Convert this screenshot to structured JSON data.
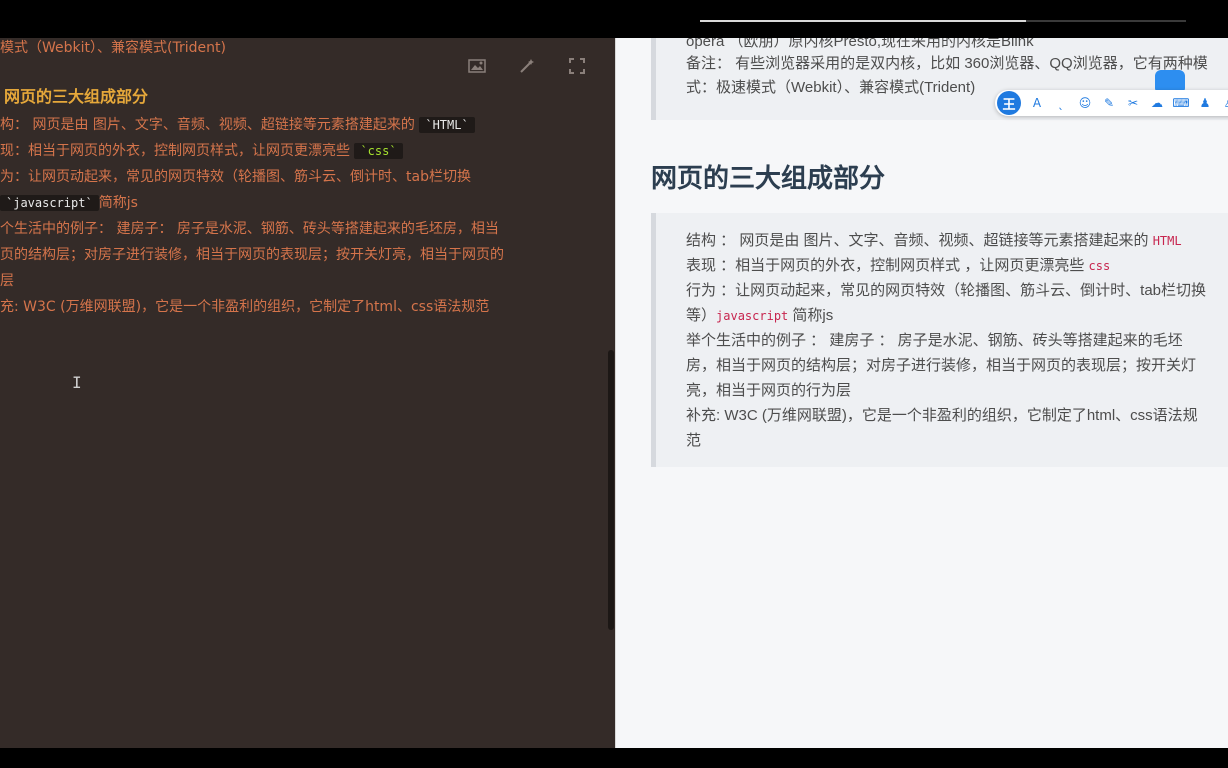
{
  "editor": {
    "lines": [
      {
        "text": "模式（Webkit）、兼容模式(Trident)"
      },
      {
        "text": "网页的三大组成部分"
      },
      {
        "pre": "构： 网页是由 图片、文字、音频、视频、超链接等元素搭建起来的 ",
        "code": "`HTML`"
      },
      {
        "pre": "现：相当于网页的外衣，控制网页样式，让网页更漂亮些 ",
        "code": "`css`"
      },
      {
        "pre": "为：让网页动起来，常见的网页特效（轮播图、筋斗云、倒计时、tab栏切换"
      },
      {
        "code": "`javascript`",
        "post": "简称js"
      },
      {
        "text": "个生活中的例子： 建房子： 房子是水泥、钢筋、砖头等搭建起来的毛坯房，相当"
      },
      {
        "text": "页的结构层；对房子进行装修，相当于网页的表现层；按开关灯亮，相当于网页的"
      },
      {
        "text": "层"
      },
      {
        "text": "充: W3C (万维网联盟)，它是一个非盈利的组织，它制定了html、css语法规范"
      }
    ],
    "toolbar": {
      "image_icon": "image-icon",
      "magic_icon": "magic-wand-icon",
      "fullscreen_icon": "fullscreen-icon"
    }
  },
  "preview": {
    "top_quote": [
      {
        "text": "opera （欧朋）原内核Presto,现在采用的内核是Blink"
      },
      {
        "text": "备注： 有些浏览器采用的是双内核，比如 360浏览器、QQ浏览器，它有两种模"
      },
      {
        "text": "式：极速模式（Webkit）、兼容模式(Trident)"
      }
    ],
    "heading": "网页的三大组成部分",
    "quote": [
      {
        "pre": "结构 ： 网页是由 图片、文字、音频、视频、超链接等元素搭建起来的 ",
        "code": "HTML"
      },
      {
        "pre": "表现 ：相当于网页的外衣，控制网页样式 ，让网页更漂亮些 ",
        "code": "css"
      },
      {
        "pre": "行为 ：让网页动起来，常见的网页特效（轮播图、筋斗云、倒计时、tab栏切换"
      },
      {
        "pre": "等）",
        "code": "javascript",
        "post": " 简称js"
      },
      {
        "pre": "举个生活中的例子 ： 建房子 ： 房子是水泥、钢筋、砖头等搭建起来的毛坯"
      },
      {
        "pre": "房，相当于网页的结构层；对房子进行装修，相当于网页的表现层；按开关灯"
      },
      {
        "pre": "亮，相当于网页的行为层"
      },
      {
        "pre": "补充: W3C (万维网联盟)，它是一个非盈利的组织，它制定了html、css语法规"
      },
      {
        "pre": "范"
      }
    ]
  },
  "ime": {
    "logo": "王",
    "icons": [
      "A",
      "ˎ",
      "☺",
      "✎",
      "✂",
      "☁",
      "⌨",
      "♟",
      "♙"
    ]
  }
}
